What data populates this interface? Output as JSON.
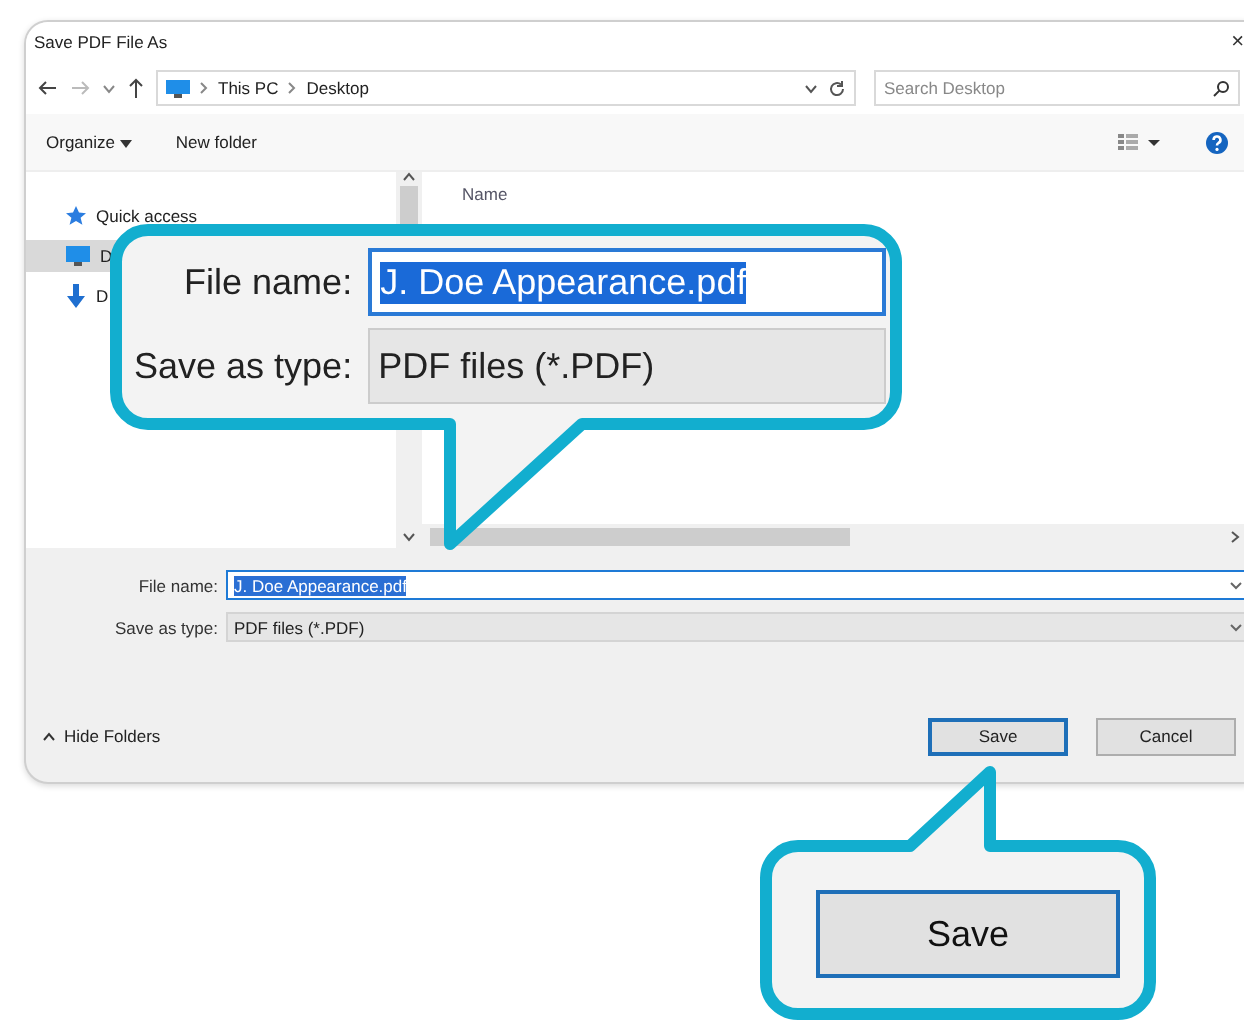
{
  "window": {
    "title": "Save PDF File As",
    "close": "×"
  },
  "address_bar": {
    "path": [
      "This PC",
      "Desktop"
    ],
    "search": {
      "placeholder": "Search Desktop"
    }
  },
  "toolbar": {
    "organize": "Organize",
    "new_folder": "New folder"
  },
  "sidebar": {
    "items": [
      {
        "label": "Quick access",
        "kind": "star",
        "selected": false
      },
      {
        "label": "D",
        "kind": "monitor",
        "selected": true
      },
      {
        "label": "D",
        "kind": "download",
        "selected": false
      }
    ]
  },
  "file_list": {
    "columns": [
      "Name"
    ]
  },
  "form": {
    "file_name": {
      "label": "File name:",
      "value": "J. Doe Appearance.pdf",
      "text_selected": true
    },
    "save_as_type": {
      "label": "Save as type:",
      "value": "PDF files (*.PDF)"
    }
  },
  "hide_folders": "Hide Folders",
  "buttons": [
    {
      "label": "Save",
      "default": true
    },
    {
      "label": "Cancel",
      "default": false
    }
  ],
  "callouts": [
    {
      "kind": "form",
      "file_name_label": "File name:",
      "file_name_value": "J. Doe Appearance.pdf",
      "text_selected": true,
      "type_label": "Save as type:",
      "type_value": "PDF files (*.PDF)"
    },
    {
      "kind": "button",
      "label": "Save"
    }
  ]
}
